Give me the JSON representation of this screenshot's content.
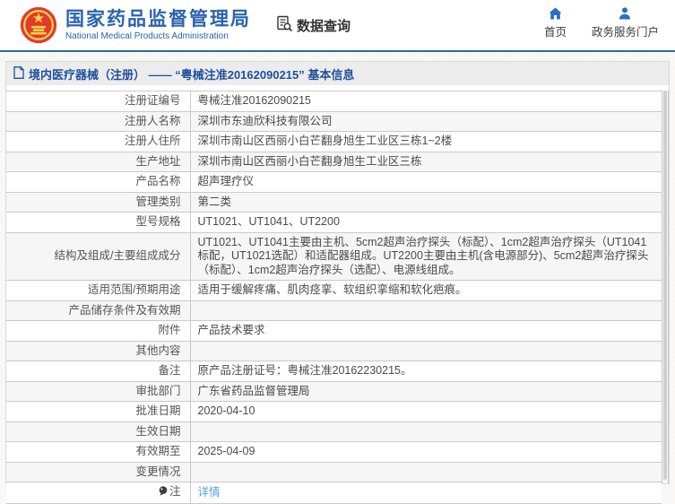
{
  "header": {
    "title": "国家药品监督管理局",
    "subtitle": "National Medical Products Administration",
    "data_query_label": "数据查询",
    "nav_home": "首页",
    "nav_portal": "政务服务门户"
  },
  "breadcrumb": {
    "title": "境内医疗器械（注册） —— “粤械注准20162090215” 基本信息"
  },
  "table": {
    "rows": [
      {
        "label": "注册证编号",
        "value": "粤械注准20162090215"
      },
      {
        "label": "注册人名称",
        "value": "深圳市东迪欣科技有限公司"
      },
      {
        "label": "注册人住所",
        "value": "深圳市南山区西丽小白芒翻身旭生工业区三栋1~2楼"
      },
      {
        "label": "生产地址",
        "value": "深圳市南山区西丽小白芒翻身旭生工业区三栋"
      },
      {
        "label": "产品名称",
        "value": "超声理疗仪"
      },
      {
        "label": "管理类别",
        "value": "第二类"
      },
      {
        "label": "型号规格",
        "value": "UT1021、UT1041、UT2200"
      },
      {
        "label": "结构及组成/主要组成成分",
        "value": "UT1021、UT1041主要由主机、5cm2超声治疗探头（标配）、1cm2超声治疗探头（UT1041标配，UT1021选配）和适配器组成。UT2200主要由主机(含电源部分)、5cm2超声治疗探头（标配）、1cm2超声治疗探头（选配）、电源线组成。"
      },
      {
        "label": "适用范围/预期用途",
        "value": "适用于缓解疼痛、肌肉痉挛、软组织挛缩和软化疤痕。"
      },
      {
        "label": "产品储存条件及有效期",
        "value": ""
      },
      {
        "label": "附件",
        "value": "产品技术要求"
      },
      {
        "label": "其他内容",
        "value": ""
      },
      {
        "label": "备注",
        "value": "原产品注册证号：粤械注准20162230215。"
      },
      {
        "label": "审批部门",
        "value": "广东省药品监督管理局"
      },
      {
        "label": "批准日期",
        "value": "2020-04-10"
      },
      {
        "label": "生效日期",
        "value": ""
      },
      {
        "label": "有效期至",
        "value": "2025-04-09"
      },
      {
        "label": "变更情况",
        "value": ""
      },
      {
        "label": "注",
        "value": "详情",
        "link": true,
        "icon": "note-icon"
      }
    ]
  },
  "colors": {
    "brand_blue": "#2a63ae",
    "nav_icon_blue": "#2a6fc0",
    "header_rule_teal": "#2a7093",
    "panel_title_blue": "#1d4f9c",
    "link_blue": "#55a0e4",
    "emblem_red": "#e23a2e",
    "emblem_gold": "#f9d64a",
    "alt_row_gray": "#f6f6f6"
  }
}
